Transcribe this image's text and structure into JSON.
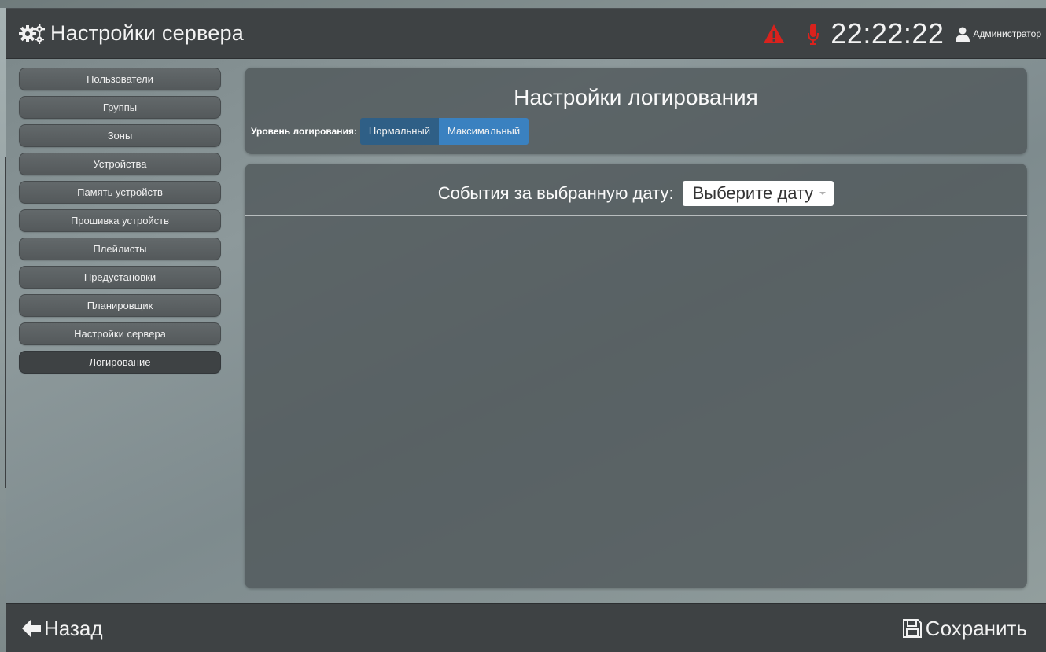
{
  "header": {
    "title": "Настройки сервера",
    "clock": "22:22:22",
    "user": "Администратор",
    "icons": [
      "gears-icon",
      "warning-icon",
      "microphone-icon",
      "user-icon"
    ],
    "colors": {
      "warning": "#d9221d",
      "microphone": "#d9221d"
    }
  },
  "sidebar": {
    "items": [
      {
        "label": "Пользователи"
      },
      {
        "label": "Группы"
      },
      {
        "label": "Зоны"
      },
      {
        "label": "Устройства"
      },
      {
        "label": "Память устройств"
      },
      {
        "label": "Прошивка устройств"
      },
      {
        "label": "Плейлисты"
      },
      {
        "label": "Предустановки"
      },
      {
        "label": "Планировщик"
      },
      {
        "label": "Настройки сервера"
      },
      {
        "label": "Логирование",
        "active": true
      }
    ]
  },
  "logging": {
    "title": "Настройки логирования",
    "level_label": "Уровень логирования:",
    "level_options": [
      "Нормальный",
      "Максимальный"
    ],
    "level_selected": "Максимальный"
  },
  "events": {
    "label": "События за выбранную дату:",
    "date_select": "Выберите дату"
  },
  "footer": {
    "back_label": "Назад",
    "save_label": "Сохранить",
    "icons": [
      "arrow-left-icon",
      "save-icon"
    ]
  },
  "colors": {
    "accent": "#3a81c0",
    "accent_dark": "#2f5f86",
    "bar": "#3e4244"
  }
}
